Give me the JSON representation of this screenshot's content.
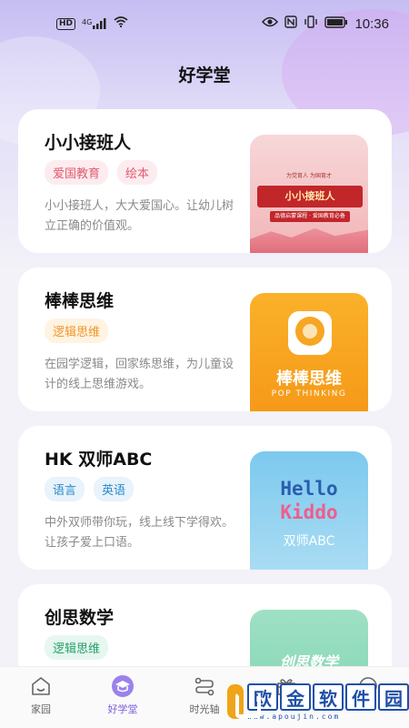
{
  "status_bar": {
    "network": "4G",
    "hd": "HD",
    "time": "10:36",
    "icons": [
      "hd-icon",
      "signal-icon",
      "wifi-icon",
      "eye-icon",
      "nfc-icon",
      "vibrate-icon",
      "battery-icon"
    ]
  },
  "header": {
    "title": "好学堂"
  },
  "courses": [
    {
      "title": "小小接班人",
      "tags": [
        "爱国教育",
        "绘本"
      ],
      "description": "小小接班人，大大爱国心。让幼儿树立正确的价值观。",
      "thumb": {
        "top_text": "为党育人 为国育才",
        "banner": "小小接班人",
        "sub": "品德启蒙课程 · 爱国教育必备"
      }
    },
    {
      "title": "棒棒思维",
      "tags": [
        "逻辑思维"
      ],
      "description": "在园学逻辑，回家练思维，为儿童设计的线上思维游戏。",
      "thumb": {
        "name": "棒棒思维",
        "en": "POP THINKING"
      }
    },
    {
      "title": "HK 双师ABC",
      "tags": [
        "语言",
        "英语"
      ],
      "description": "中外双师带你玩，线上线下学得欢。让孩子爱上口语。",
      "thumb": {
        "line1": "Hello",
        "line2": "Kiddo",
        "sub": "双师ABC"
      }
    },
    {
      "title": "创思数学",
      "tags": [
        "逻辑思维"
      ],
      "description": "",
      "thumb": {
        "name": "创思数学"
      }
    }
  ],
  "tabbar": {
    "items": [
      {
        "label": "家园",
        "icon": "home-icon"
      },
      {
        "label": "好学堂",
        "icon": "graduation-cap-icon",
        "active": true
      },
      {
        "label": "时光轴",
        "icon": "timeline-icon"
      },
      {
        "label": "",
        "icon": "gift-icon"
      },
      {
        "label": "",
        "icon": "face-icon"
      }
    ]
  },
  "watermark": {
    "chars": [
      "欧",
      "金",
      "软",
      "件",
      "园"
    ],
    "url": "www.apoujin.com"
  },
  "colors": {
    "accent": "#7b5be0",
    "tag_pink": "#e25a6f",
    "tag_orange": "#f0962e",
    "tag_blue": "#2b8ac9",
    "tag_green": "#27a06b"
  }
}
